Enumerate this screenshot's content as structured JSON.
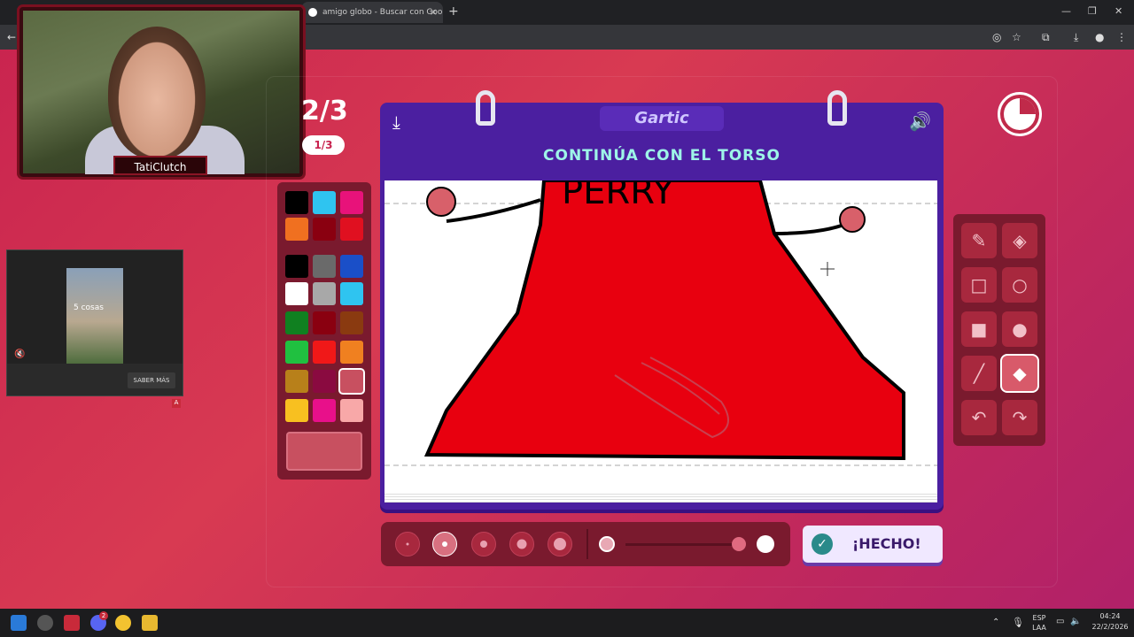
{
  "browser": {
    "tab_title": "amigo globo - Buscar con Goo...",
    "new_tab": "+",
    "tab_close": "×"
  },
  "webcam": {
    "streamer_name": "TatiClutch"
  },
  "ad": {
    "video_text": "5 cosas",
    "cta": "SABER MÁS",
    "badge": "A"
  },
  "game": {
    "round_label": "2/3",
    "round_pill": "1/3",
    "logo": "Gartic",
    "instruction": "CONTINÚA CON EL TORSO",
    "canvas_text": "PERRY",
    "done_button": "¡HECHO!",
    "selected_color": "#c85060"
  },
  "palette": {
    "colors": [
      "#000000",
      "#2fc4f0",
      "#e8127a",
      "#f07020",
      "#8a0010",
      "#e01020",
      "#000000",
      "#6a6a6a",
      "#1a4fc8",
      "#ffffff",
      "#a8a8a8",
      "#2fc4f0",
      "#108020",
      "#8a0010",
      "#8a3a10",
      "#20c040",
      "#f01818",
      "#f08020",
      "#b8801a",
      "#8a0a40",
      "#c85060",
      "#f8c020",
      "#e8108a",
      "#f8a8a8"
    ]
  },
  "tools": [
    "pencil-icon",
    "eraser-icon",
    "rectangle-outline-icon",
    "ellipse-outline-icon",
    "rectangle-filled-icon",
    "ellipse-filled-icon",
    "line-icon",
    "bucket-icon",
    "undo-icon",
    "redo-icon"
  ],
  "taskbar": {
    "lang_1": "ESP",
    "lang_2": "LAA",
    "time": "04:24",
    "date": "22/2/2026",
    "badge": "2"
  }
}
